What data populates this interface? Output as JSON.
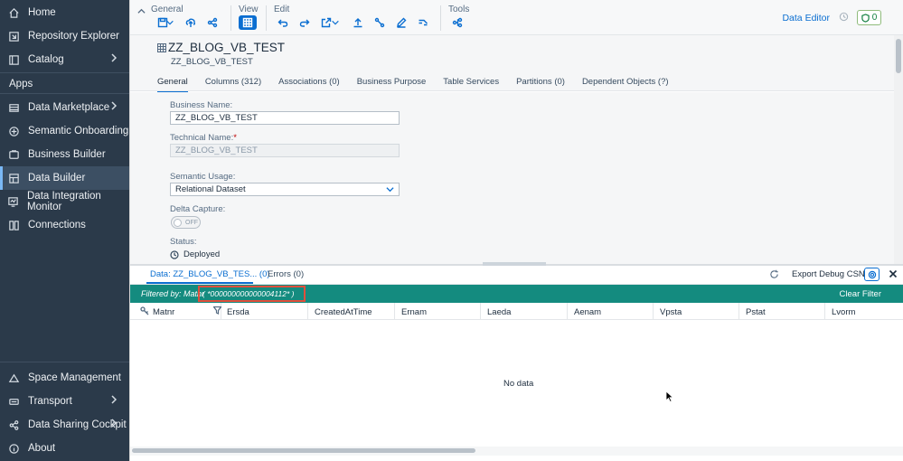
{
  "sidebar": {
    "items_top": [
      {
        "label": "Home",
        "icon": "home-icon"
      },
      {
        "label": "Repository Explorer",
        "icon": "repository-icon"
      },
      {
        "label": "Catalog",
        "icon": "catalog-icon",
        "has_submenu": true
      }
    ],
    "apps_label": "Apps",
    "items_apps": [
      {
        "label": "Data Marketplace",
        "icon": "marketplace-icon",
        "has_submenu": true
      },
      {
        "label": "Semantic Onboarding",
        "icon": "onboarding-icon"
      },
      {
        "label": "Business Builder",
        "icon": "business-builder-icon"
      },
      {
        "label": "Data Builder",
        "icon": "data-builder-icon",
        "active": true
      },
      {
        "label": "Data Integration Monitor",
        "icon": "monitor-icon"
      },
      {
        "label": "Connections",
        "icon": "connections-icon"
      }
    ],
    "items_bottom": [
      {
        "label": "Space Management",
        "icon": "space-icon"
      },
      {
        "label": "Transport",
        "icon": "transport-icon",
        "has_submenu": true
      },
      {
        "label": "Data Sharing Cockpit",
        "icon": "share-icon",
        "has_submenu": true
      },
      {
        "label": "About",
        "icon": "info-icon"
      }
    ]
  },
  "toolbar": {
    "groups": {
      "general": "General",
      "view": "View",
      "edit": "Edit",
      "tools": "Tools"
    },
    "data_editor": "Data Editor",
    "validation_count": "0"
  },
  "object": {
    "title": "ZZ_BLOG_VB_TEST",
    "subtitle": "ZZ_BLOG_VB_TEST",
    "tabs": [
      "General",
      "Columns (312)",
      "Associations (0)",
      "Business Purpose",
      "Table Services",
      "Partitions (0)",
      "Dependent Objects (?)"
    ],
    "active_tab": "General"
  },
  "form": {
    "business_name_label": "Business Name:",
    "business_name_value": "ZZ_BLOG_VB_TEST",
    "technical_name_label": "Technical Name:",
    "technical_name_required": "*",
    "technical_name_value": "ZZ_BLOG_VB_TEST",
    "semantic_usage_label": "Semantic Usage:",
    "semantic_usage_value": "Relational Dataset",
    "delta_capture_label": "Delta Capture:",
    "delta_capture_value": "OFF",
    "status_label": "Status:",
    "status_value": "Deployed"
  },
  "data_panel": {
    "tabs": {
      "data": "Data: ZZ_BLOG_VB_TES... (0)",
      "errors": "Errors (0)"
    },
    "export_label": "Export Debug CSN",
    "filter_label": "Filtered by: Matnr",
    "filter_value": "( *000000000000004112* )",
    "clear_filter": "Clear Filter",
    "columns": [
      "Matnr",
      "Ersda",
      "CreatedAtTime",
      "Ernam",
      "Laeda",
      "Aenam",
      "Vpsta",
      "Pstat",
      "Lvorm"
    ],
    "no_data": "No data"
  },
  "colors": {
    "sidebar_bg": "#2b3a4a",
    "accent": "#0a6ed1",
    "filter_bar": "#148b7f",
    "highlight_border": "#e04f3c"
  }
}
